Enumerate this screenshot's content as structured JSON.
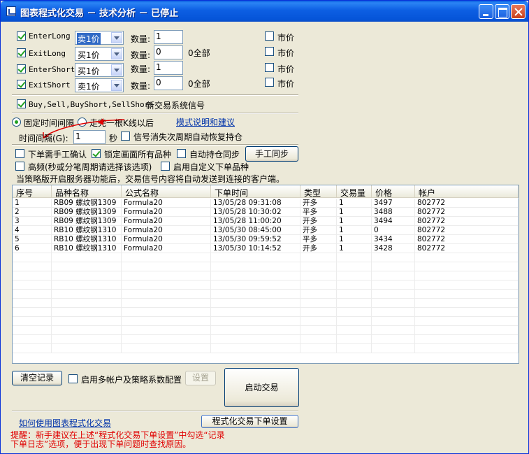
{
  "window": {
    "title": "图表程式化交易 － 技术分析 － 已停止"
  },
  "orders": [
    {
      "label": "EnterLong",
      "price_type": "卖1价",
      "qty_label": "数量:",
      "qty": "1",
      "note": "",
      "market_label": "市价",
      "selected": true
    },
    {
      "label": "ExitLong",
      "price_type": "买1价",
      "qty_label": "数量:",
      "qty": "0",
      "note": "0全部",
      "market_label": "市价",
      "selected": false
    },
    {
      "label": "EnterShort",
      "price_type": "买1价",
      "qty_label": "数量:",
      "qty": "1",
      "note": "",
      "market_label": "市价",
      "selected": false
    },
    {
      "label": "ExitShort",
      "price_type": "卖1价",
      "qty_label": "数量:",
      "qty": "0",
      "note": "0全部",
      "market_label": "市价",
      "selected": false
    }
  ],
  "signal": {
    "prefix": "Buy,Sell,BuyShort,SellShort",
    "suffix": "新交易系统信号"
  },
  "mode": {
    "fixed_interval": "固定时间间隔",
    "after_bar": "走完一根K线以后",
    "help_link": "模式说明和建议",
    "interval_label": "时间间隔(G):",
    "interval_value": "1",
    "seconds": "秒",
    "auto_restore": "信号消失次周期自动恢复持仓"
  },
  "options": {
    "manual_confirm": "下单需手工确认",
    "lock_all": "锁定画面所有品种",
    "auto_sync": "自动持仓同步",
    "manual_sync": "手工同步",
    "high_freq": "高频(秒或分笔周期请选择该选项)",
    "custom_symbol": "启用自定义下单品种",
    "server_note": "当策略版开启服务器功能后，交易信号内容将自动发送到连接的客户端。"
  },
  "table": {
    "columns": [
      "序号",
      "品种名称",
      "公式名称",
      "下单时间",
      "类型",
      "交易量",
      "价格",
      "帐户"
    ],
    "rows": [
      [
        "1",
        "RB09 螺纹钢1309",
        "Formula20",
        "13/05/28 09:31:08",
        "开多",
        "1",
        "3497",
        "802772"
      ],
      [
        "2",
        "RB09 螺纹钢1309",
        "Formula20",
        "13/05/28 10:30:02",
        "平多",
        "1",
        "3488",
        "802772"
      ],
      [
        "3",
        "RB09 螺纹钢1309",
        "Formula20",
        "13/05/28 11:00:20",
        "开多",
        "1",
        "3494",
        "802772"
      ],
      [
        "4",
        "RB10 螺纹钢1310",
        "Formula20",
        "13/05/30 08:45:00",
        "开多",
        "1",
        "0",
        "802772"
      ],
      [
        "5",
        "RB10 螺纹钢1310",
        "Formula20",
        "13/05/30 09:59:52",
        "平多",
        "1",
        "3434",
        "802772"
      ],
      [
        "6",
        "RB10 螺纹钢1310",
        "Formula20",
        "13/05/30 10:14:52",
        "开多",
        "1",
        "3428",
        "802772"
      ]
    ]
  },
  "bottom": {
    "clear": "清空记录",
    "multi_account": "启用多帐户及策略系数配置",
    "settings": "设置",
    "start": "启动交易",
    "howto_link": "如何使用图表程式化交易",
    "order_settings": "程式化交易下单设置",
    "tip_line1": "提醒：新手建议在上述“程式化交易下单设置”中勾选“记录",
    "tip_line2": "下单日志”选项，便于出现下单问题时查找原因。"
  }
}
